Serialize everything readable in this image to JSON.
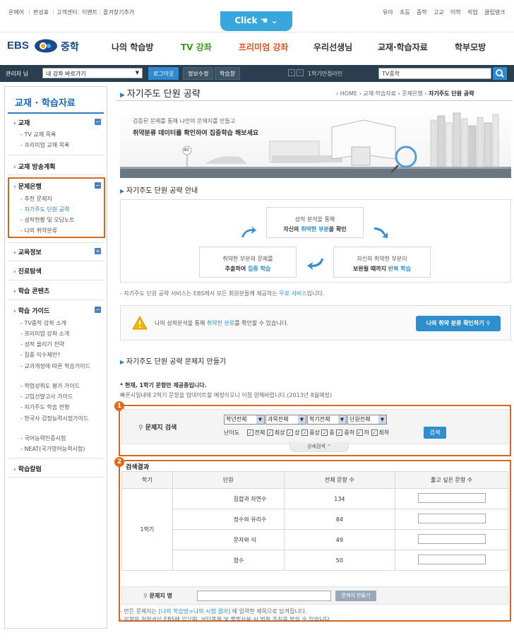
{
  "topbar": {
    "left_links": [
      "온에어",
      "편성표",
      "고객센터",
      "이벤트",
      "즐겨찾기추가"
    ],
    "click_label": "Click",
    "right_links": [
      "유아",
      "초등",
      "중학",
      "고교",
      "어학",
      "직업",
      "클립뱅크"
    ]
  },
  "logo": {
    "ebs": "EBS",
    "grade": "중학"
  },
  "gnav": [
    "나의 학습방",
    "TV 강좌",
    "프리미엄 강좌",
    "우리선생님",
    "교재·학습자료",
    "학부모방"
  ],
  "colors": {
    "gnav_tv": "#3a9a1e",
    "gnav_premium": "#e0531a",
    "accent": "#2e7dc6",
    "highlight_box": "#d2691e"
  },
  "adminbar": {
    "user": "관리자 님",
    "select_label": "내 강좌 바로가기",
    "logout": "로그아웃",
    "edit_info": "정보수정",
    "study": "학습창",
    "ticker": "1학기만점라인",
    "search_value": "TV중학"
  },
  "sidebar": {
    "title": "교재 · 학습자료",
    "sections": [
      {
        "label": "교재",
        "toggle": "−",
        "items": [
          "TV 교재 목록",
          "프리미엄 교재 목록"
        ]
      },
      {
        "label": "교재 방송계획",
        "toggle": "",
        "items": []
      },
      {
        "label": "문제은행",
        "toggle": "−",
        "items": [
          "추천 문제지",
          "자기주도 단원 공략",
          "성적현황 및 오답노트",
          "나의 취약분류"
        ]
      },
      {
        "label": "교육정보",
        "toggle": "+",
        "items": []
      },
      {
        "label": "진로탐색",
        "toggle": "",
        "items": []
      },
      {
        "label": "학습 콘텐츠",
        "toggle": "",
        "items": []
      },
      {
        "label": "학습 가이드",
        "toggle": "−",
        "items": [
          "TV중학 강좌 소개",
          "프리미엄 강좌 소개",
          "성적 올리기 전략",
          "집중 이수제란?",
          "교과개정에 따른 학습가이드",
          "학업성취도 평가 가이드",
          "고입선발고사 가이드",
          "자기주도 학습 전형",
          "한국사 검정능력시험가이드",
          "국어능력인증시험",
          "NEAT(국가영어능력시험)"
        ]
      },
      {
        "label": "학습칼럼",
        "toggle": "",
        "items": []
      }
    ]
  },
  "page": {
    "title": "자기주도 단원 공략",
    "breadcrumb": [
      "HOME",
      "교재·학습자료",
      "문제은행",
      "자기주도 단원 공략"
    ]
  },
  "banner": {
    "line1": "검증된 문제를 통해 나만의 문제지를 만들고",
    "line2": "취약분류 데이터를 확인하여 집중학습 해보세요",
    "sign": "40"
  },
  "guide": {
    "heading": "자기주도 단원 공략 안내",
    "step1": {
      "l1": "성적 분석을 통해",
      "l2a": "자신의 ",
      "l2b": "취약한 부분",
      "l2c": "을 확인"
    },
    "step2": {
      "l1": "자신의 취약한 부분이",
      "l2a": "보완될 때까지 ",
      "l2b": "반복 학습"
    },
    "step3": {
      "l1": "취약한 부분의 문제를",
      "l2a": "추출하여 ",
      "l2b": "집중 학습"
    },
    "note_a": "- 자기주도 단원 공략 서비스는 EBS에서 모든 회원분들께 제공하는 ",
    "note_b": "무료 서비스",
    "note_c": "입니다."
  },
  "weak": {
    "text_a": "나의 성적분석을 통해 ",
    "text_b": "취약한 분류",
    "text_c": "를 확인할 수 있습니다.",
    "button": "나의 취약 분류 확인하기"
  },
  "make": {
    "heading": "자기주도 단원 공략 문제지 만들기",
    "notice1": "* 현재, 1학기 문항만 제공중입니다.",
    "notice2": "빠른시일내에 2학기 문항을 업데이트할 예정이오니 이점 양해바랍니다.(2013년 8월예정)"
  },
  "search": {
    "badge": "1",
    "label": "문제지 검색",
    "selects": [
      "학년전체",
      "과목전체",
      "학기전체",
      "단원전체"
    ],
    "difficulty_label": "난이도",
    "difficulty": [
      "전체",
      "최상",
      "상",
      "중상",
      "중",
      "중하",
      "하",
      "최하"
    ],
    "button": "검색",
    "more": "상세검색"
  },
  "results": {
    "badge": "2",
    "heading": "검색결과",
    "columns": [
      "학기",
      "단원",
      "전체 문항 수",
      "풀고 싶은 문항 수"
    ],
    "semester": "1학기",
    "rows": [
      {
        "unit": "집합과 자연수",
        "count": "134"
      },
      {
        "unit": "정수와 유리수",
        "count": "84"
      },
      {
        "unit": "문자와 식",
        "count": "49"
      },
      {
        "unit": "함수",
        "count": "50"
      }
    ]
  },
  "name_row": {
    "label": "문제지 명",
    "button": "문제지 만들기"
  },
  "footer": {
    "note1a": "- 만든 문제지는 ",
    "note1b": "[나의 학습방>나의 시험 결과]",
    "note1c": " 에 입력한 제목으로 담겨집니다.",
    "note2": "- 문항의 저작권은 EBS에 있으며, 무단복제 및 불법사용 시 법적 조치를 받을 수 있습니다."
  }
}
